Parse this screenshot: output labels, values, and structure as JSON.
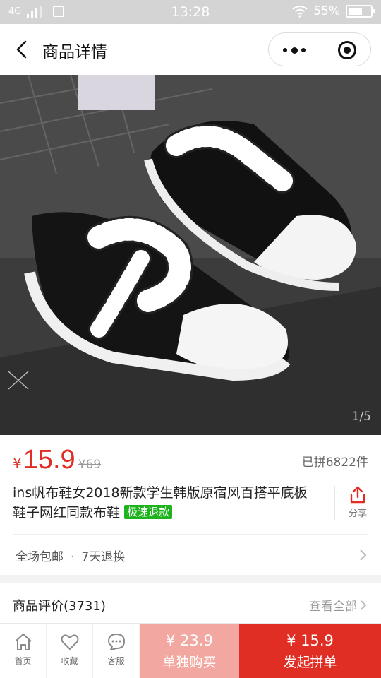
{
  "status_bar": {
    "network": "4G",
    "time": "13:28",
    "battery": "55%"
  },
  "nav": {
    "title": "商品详情"
  },
  "gallery": {
    "counter": "1/5"
  },
  "product": {
    "currency": "¥",
    "price": "15.9",
    "original_price": "¥69",
    "sold": "已拼6822件",
    "title": "ins帆布鞋女2018新款学生韩版原宿风百搭平底板鞋子网红同款布鞋",
    "tag": "极速退款",
    "share_label": "分享"
  },
  "policy": {
    "item1": "全场包邮",
    "separator": "·",
    "item2": "7天退换"
  },
  "reviews": {
    "title": "商品评价(3731)",
    "view_all": "查看全部"
  },
  "bottom_bar": {
    "home": "首页",
    "favorite": "收藏",
    "service": "客服",
    "solo_price": "¥ 23.9",
    "solo_label": "单独购买",
    "group_price": "¥ 15.9",
    "group_label": "发起拼单"
  },
  "colors": {
    "accent": "#e02e24",
    "solo_button": "#f3a7a1",
    "tag_green": "#1db31d"
  }
}
